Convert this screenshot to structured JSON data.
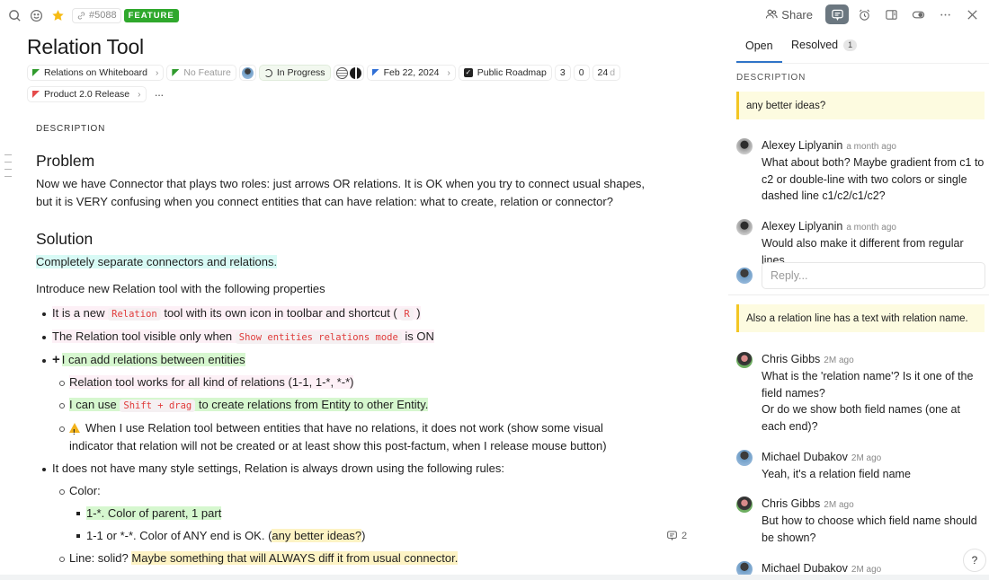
{
  "topbar": {
    "icons_left": [
      "search-icon",
      "emoji-icon",
      "star-icon"
    ],
    "issue_id": "#5088",
    "type_badge": "FEATURE",
    "share_label": "Share",
    "icons_right": [
      "comments-icon",
      "alarm-icon",
      "panel-icon",
      "toggle-icon",
      "more-icon",
      "close-icon"
    ],
    "colors": {
      "badge": "#2fa82c",
      "active_icon_bg": "#6b7780"
    }
  },
  "doc": {
    "title": "Relation Tool",
    "properties": {
      "feature": "Relations on Whiteboard",
      "parent_feature": "No Feature",
      "status": "In Progress",
      "date": "Feb 22, 2024",
      "roadmap": "Public Roadmap",
      "count_a": "3",
      "count_b": "0",
      "age_value": "24",
      "age_unit": "d",
      "release": "Product 2.0 Release",
      "more": "···"
    },
    "section_label": "DESCRIPTION",
    "problem_heading": "Problem",
    "problem_text": "Now we have Connector that plays two roles: just arrows OR relations. It is OK when you try to connect usual shapes, but it is VERY confusing when you connect entities that can have relation: what to create, relation or connector?",
    "solution_heading": "Solution",
    "solution_highlight": "Completely separate connectors and relations.",
    "intro": "Introduce new Relation tool with the following properties",
    "bullets": {
      "b1_pre": "It is a new ",
      "b1_code": "Relation",
      "b1_mid": " tool with its own icon in toolbar and shortcut ( ",
      "b1_code2": "R",
      "b1_post": " )",
      "b2_pre": "The Relation tool visible only when ",
      "b2_code": "Show entities relations mode",
      "b2_post": " is ON",
      "b3_plus": "+",
      "b3_text": "I can add relations between entities",
      "b3a": "Relation tool works for all kind of relations (1-1, 1-*, *-*)",
      "b3b_pre": "I can use ",
      "b3b_code": "Shift + drag",
      "b3b_post": " to create relations from Entity to other Entity.",
      "b3c": "When I use Relation tool between entities that have no relations, it does not work (show some visual indicator that relation will not be created or at least show this post-factum, when I release mouse button)",
      "b4": "It does not have many style settings, Relation is always drown using the following rules:",
      "b4a": "Color:",
      "b4a1": "1-*. Color of parent, 1 part",
      "b4a2_pre": "1-1 or *-*. Color of ANY end is OK. (",
      "b4a2_hl": "any better ideas?",
      "b4a2_post": ")",
      "b4b_pre": "Line: solid? ",
      "b4b_hl": "Maybe something that will ALWAYS diff it from usual connector."
    },
    "inline_comment_count": "2"
  },
  "panel": {
    "tabs": [
      {
        "label": "Open",
        "active": true
      },
      {
        "label": "Resolved",
        "count": "1"
      }
    ],
    "section_label": "DESCRIPTION",
    "threads": [
      {
        "quote": "any better ideas?",
        "comments": [
          {
            "author": "Alexey Liplyanin",
            "time": "a month ago",
            "text": "What about both? Maybe gradient from c1 to c2 or double-line with two colors or single dashed line c1/c2/c1/c2?"
          },
          {
            "author": "Alexey Liplyanin",
            "time": "a month ago",
            "text": "Would also make it different from regular lines"
          }
        ],
        "reply_placeholder": "Reply..."
      },
      {
        "quote": "Also a relation line has a text with relation name.",
        "comments": [
          {
            "author": "Chris Gibbs",
            "time": "2M ago",
            "text": "What is the 'relation name'? Is it one of the field names?\nOr do we show both field names (one at each end)?"
          },
          {
            "author": "Michael Dubakov",
            "time": "2M ago",
            "text": "Yeah, it's a relation field name"
          },
          {
            "author": "Chris Gibbs",
            "time": "2M ago",
            "text": "But how to choose which field name should be shown?"
          },
          {
            "author": "Michael Dubakov",
            "time": "2M ago",
            "text": ""
          }
        ]
      }
    ],
    "help_label": "?"
  }
}
